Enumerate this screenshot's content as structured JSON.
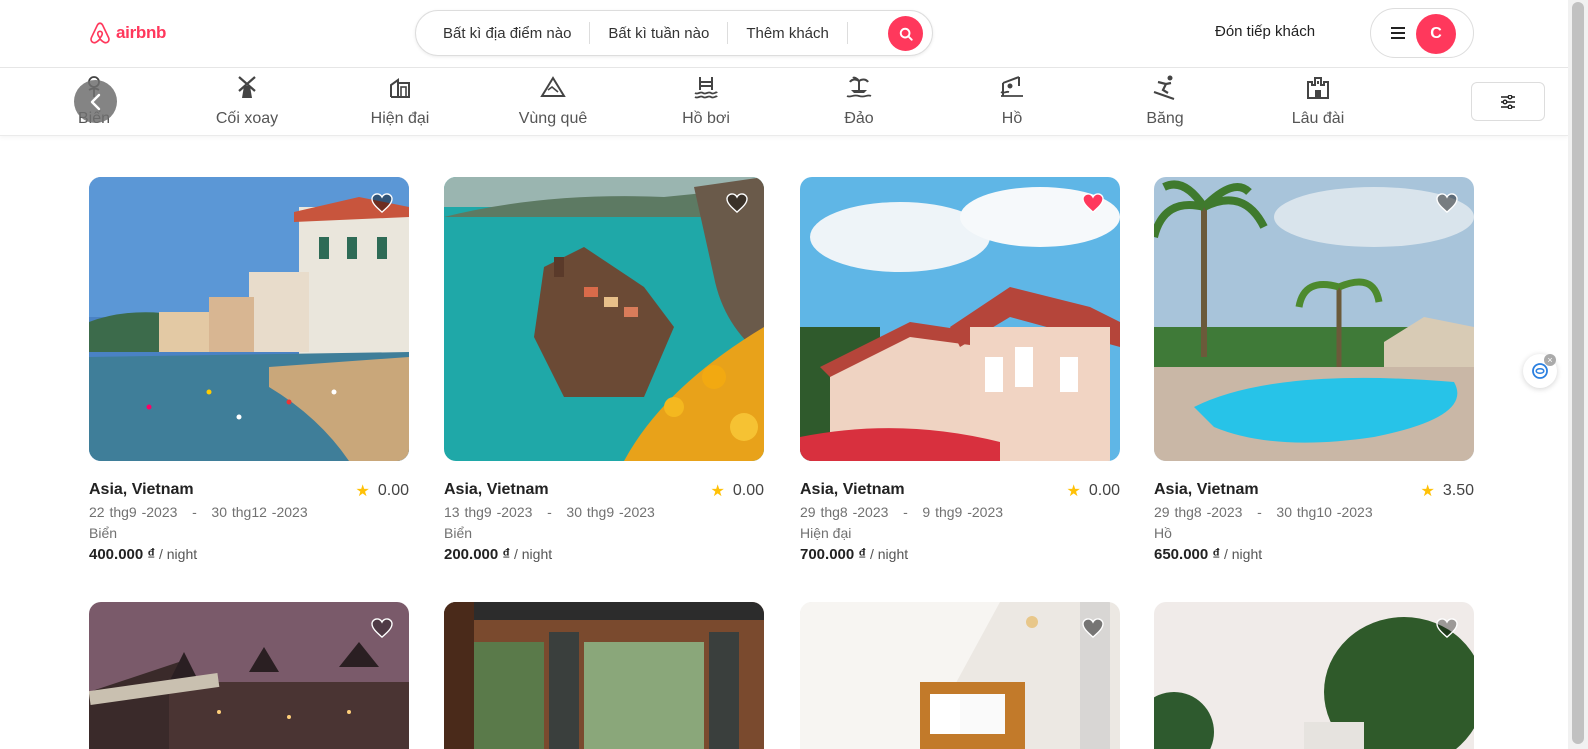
{
  "header": {
    "logo_text": "airbnb",
    "search": {
      "where": "Bất kì địa điểm nào",
      "when": "Bất kì tuần nào",
      "who": "Thêm khách"
    },
    "host_label": "Đón tiếp khách",
    "avatar_initial": "C"
  },
  "categories": [
    {
      "label": "Biển",
      "icon": "beach-icon"
    },
    {
      "label": "Cối xoay",
      "icon": "windmill-icon"
    },
    {
      "label": "Hiện đại",
      "icon": "modern-house-icon"
    },
    {
      "label": "Vùng quê",
      "icon": "countryside-icon"
    },
    {
      "label": "Hồ bơi",
      "icon": "pool-icon"
    },
    {
      "label": "Đảo",
      "icon": "island-icon"
    },
    {
      "label": "Hồ",
      "icon": "lake-icon"
    },
    {
      "label": "Băng",
      "icon": "ski-icon"
    },
    {
      "label": "Lâu đài",
      "icon": "castle-icon"
    }
  ],
  "listings": [
    {
      "location": "Asia, Vietnam",
      "rating": "0.00",
      "dates": "22 thg9 -2023   -   30 thg12 -2023",
      "type": "Biển",
      "price": "400.000 ₫",
      "unit": " / night",
      "favorite": false
    },
    {
      "location": "Asia, Vietnam",
      "rating": "0.00",
      "dates": "13 thg9 -2023   -   30 thg9 -2023",
      "type": "Biển",
      "price": "200.000 ₫",
      "unit": " / night",
      "favorite": false
    },
    {
      "location": "Asia, Vietnam",
      "rating": "0.00",
      "dates": "29 thg8 -2023   -   9 thg9 -2023",
      "type": "Hiện đại",
      "price": "700.000 ₫",
      "unit": " / night",
      "favorite": true
    },
    {
      "location": "Asia, Vietnam",
      "rating": "3.50",
      "dates": "29 thg8 -2023   -   30 thg10 -2023",
      "type": "Hồ",
      "price": "650.000 ₫",
      "unit": " / night",
      "favorite": false
    }
  ],
  "colors": {
    "brand": "#ff385c",
    "star": "#ffc107"
  }
}
